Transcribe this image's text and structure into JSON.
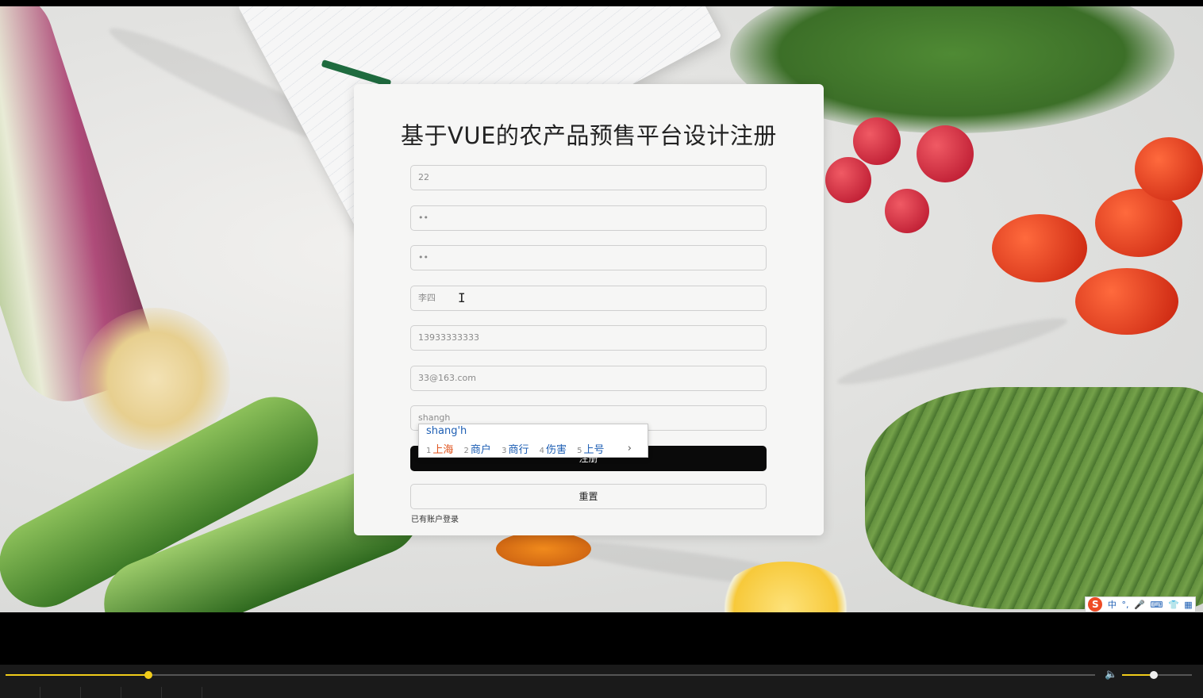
{
  "form": {
    "title": "基于VUE的农产品预售平台设计注册",
    "fields": [
      {
        "name": "account",
        "value": "22"
      },
      {
        "name": "password",
        "value": "••"
      },
      {
        "name": "confirm-password",
        "value": "••"
      },
      {
        "name": "real-name",
        "value": "李四"
      },
      {
        "name": "phone",
        "value": "13933333333"
      },
      {
        "name": "email",
        "value": "33@163.com"
      },
      {
        "name": "address",
        "value": "shangh"
      }
    ],
    "register_label": "注册",
    "reset_label": "重置",
    "login_link": "已有账户登录"
  },
  "ime": {
    "composition": "shang'h",
    "candidates": [
      {
        "num": "1",
        "text": "上海"
      },
      {
        "num": "2",
        "text": "商户"
      },
      {
        "num": "3",
        "text": "商行"
      },
      {
        "num": "4",
        "text": "伤害"
      },
      {
        "num": "5",
        "text": "上号"
      }
    ],
    "next_glyph": "›",
    "toolbar": {
      "logo": "S",
      "mode": "中",
      "punct": "°,",
      "mic": "🎤",
      "keyboard": "⌨",
      "skin": "👕",
      "menu": "▦"
    }
  },
  "player": {
    "progress": 0.131,
    "volume": 0.45
  },
  "colors": {
    "accent": "#f1cc1a",
    "button_dark": "#0a0a0a",
    "ime_blue": "#1e5fb4",
    "ime_first": "#e0531c"
  }
}
